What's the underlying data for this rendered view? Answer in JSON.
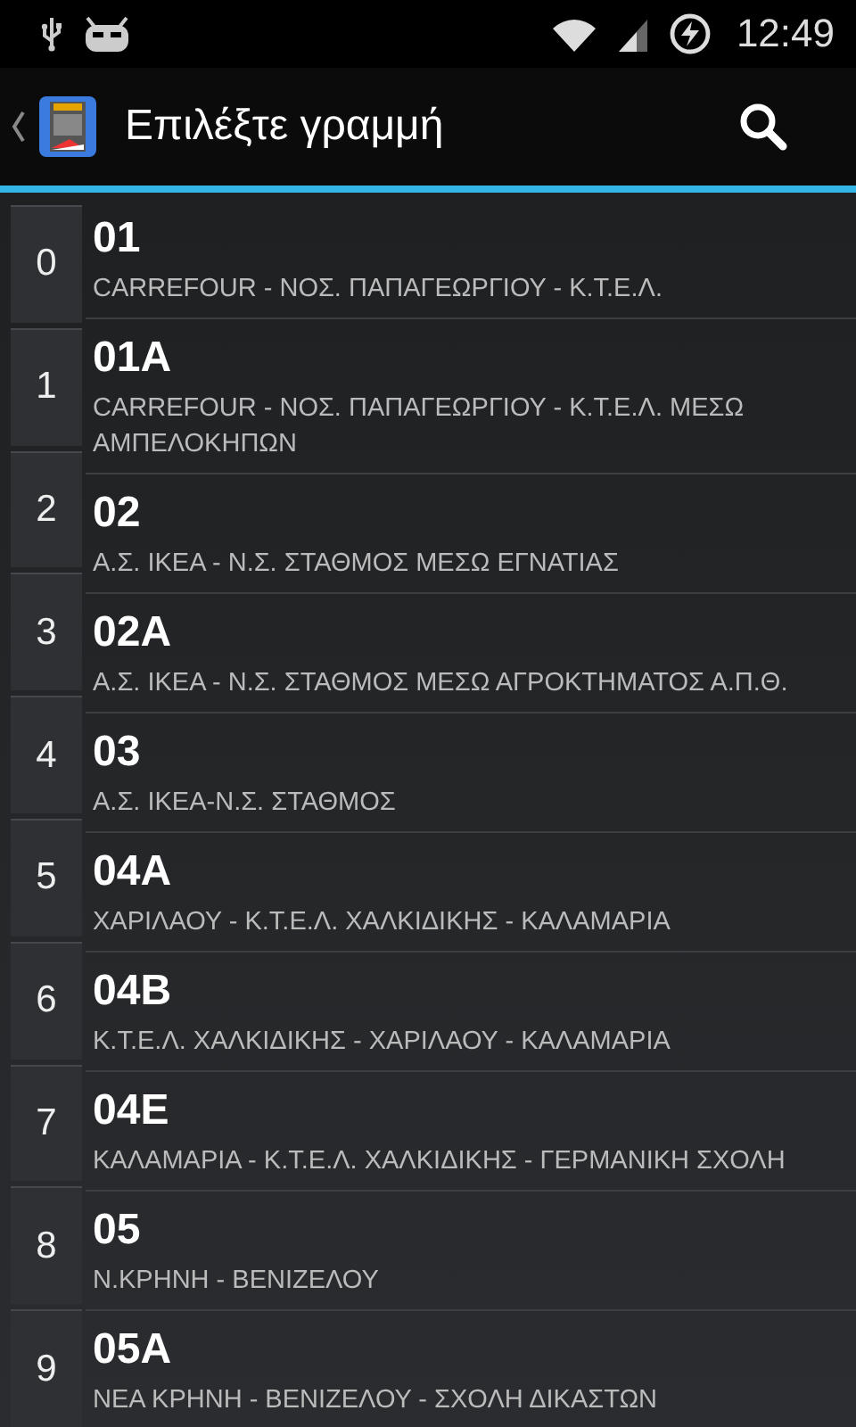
{
  "status_bar": {
    "time": "12:49"
  },
  "action_bar": {
    "title": "Επιλέξτε γραμμή"
  },
  "index": [
    "0",
    "1",
    "2",
    "3",
    "4",
    "5",
    "6",
    "7",
    "8",
    "9"
  ],
  "lines": [
    {
      "number": "01",
      "route": "CARREFOUR - ΝΟΣ. ΠΑΠΑΓΕΩΡΓΙΟΥ - Κ.Τ.Ε.Λ."
    },
    {
      "number": "01A",
      "route": "CARREFOUR - ΝΟΣ. ΠΑΠΑΓΕΩΡΓΙΟΥ - Κ.Τ.Ε.Λ. ΜΕΣΩ ΑΜΠΕΛΟΚΗΠΩΝ"
    },
    {
      "number": "02",
      "route": "Α.Σ. ΙΚΕΑ - Ν.Σ. ΣΤΑΘΜΟΣ ΜΕΣΩ ΕΓΝΑΤΙΑΣ"
    },
    {
      "number": "02A",
      "route": "Α.Σ. ΙΚΕΑ - Ν.Σ. ΣΤΑΘΜΟΣ ΜΕΣΩ ΑΓΡΟΚΤΗΜΑΤΟΣ Α.Π.Θ."
    },
    {
      "number": "03",
      "route": "Α.Σ. ΙΚΕΑ-Ν.Σ. ΣΤΑΘΜΟΣ"
    },
    {
      "number": "04A",
      "route": "ΧΑΡΙΛΑΟΥ - Κ.Τ.Ε.Λ. ΧΑΛΚΙΔΙΚΗΣ - ΚΑΛΑΜΑΡΙΑ"
    },
    {
      "number": "04B",
      "route": "Κ.Τ.Ε.Λ. ΧΑΛΚΙΔΙΚΗΣ - ΧΑΡΙΛΑΟΥ - ΚΑΛΑΜΑΡΙΑ"
    },
    {
      "number": "04E",
      "route": "ΚΑΛΑΜΑΡΙΑ - Κ.Τ.Ε.Λ. ΧΑΛΚΙΔΙΚΗΣ - ΓΕΡΜΑΝΙΚΗ ΣΧΟΛΗ"
    },
    {
      "number": "05",
      "route": "Ν.ΚΡΗΝΗ - ΒΕΝΙΖΕΛΟΥ"
    },
    {
      "number": "05A",
      "route": "ΝΕΑ ΚΡΗΝΗ - ΒΕΝΙΖΕΛΟΥ - ΣΧΟΛΗ ΔΙΚΑΣΤΩΝ"
    }
  ]
}
